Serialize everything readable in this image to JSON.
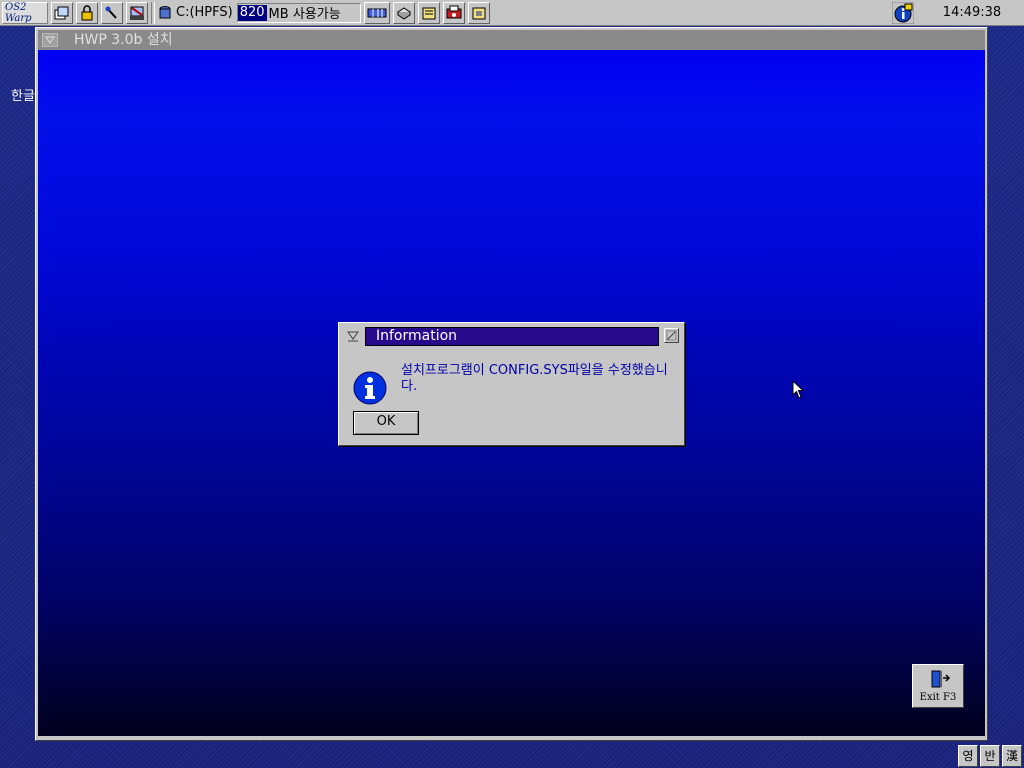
{
  "topbar": {
    "logo": "OS2 Warp",
    "drive_label": "C:(HPFS)",
    "free_space_value": "820",
    "free_space_label": "MB 사용가능",
    "clock": "14:49:38",
    "icons": [
      "window-list-icon",
      "lock-icon",
      "find-icon",
      "shredder-icon",
      "drive-icon",
      "memory-icon",
      "printer-icon",
      "folder-icon",
      "fax-icon",
      "folder2-icon",
      "info-icon"
    ]
  },
  "desktop": {
    "label": "한글"
  },
  "main_window": {
    "title": "HWP 3.0b 설치"
  },
  "dialog": {
    "title": "Information",
    "message": "설치프로그램이 CONFIG.SYS파일을 수정했습니다.",
    "ok_label": "OK",
    "icon": "info-icon"
  },
  "exit_button": {
    "label": "Exit F3",
    "icon": "exit-door-icon"
  },
  "ime": {
    "mode1": "영",
    "mode2": "반",
    "mode3": "漢"
  },
  "colors": {
    "dialog_title_bg": "#2a0a8c",
    "dialog_text": "#0000a8",
    "client_top": "#0000f2",
    "client_bottom": "#00011e"
  }
}
